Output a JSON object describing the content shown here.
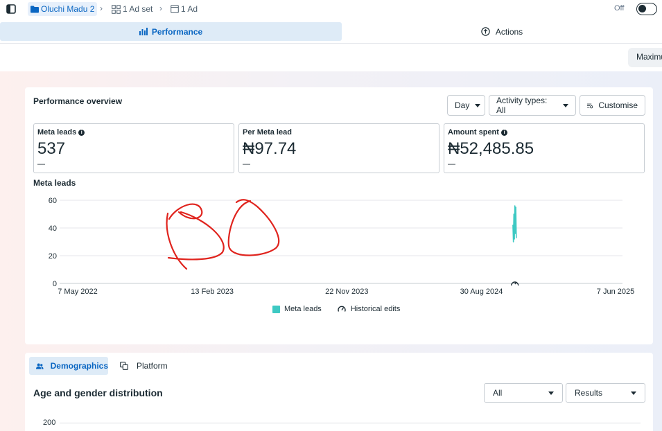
{
  "breadcrumb": {
    "campaign": "Oluchi Madu 2",
    "ad_set": "1 Ad set",
    "ad": "1 Ad"
  },
  "status_toggle": {
    "label": "Off",
    "on": false
  },
  "tabs": {
    "performance": "Performance",
    "actions": "Actions"
  },
  "maximize_button": "Maximu",
  "overview": {
    "title": "Performance overview",
    "day_select": "Day",
    "activity_select": "Activity types: All",
    "customise": "Customise",
    "metrics": [
      {
        "label": "Meta leads",
        "value": "537",
        "delta": "—",
        "info": true
      },
      {
        "label": "Per Meta lead",
        "value": "₦97.74",
        "delta": "—",
        "info": false
      },
      {
        "label": "Amount spent",
        "value": "₦52,485.85",
        "delta": "—",
        "info": true
      }
    ]
  },
  "chart_data": {
    "type": "line",
    "title": "Meta leads",
    "ylim": [
      0,
      60
    ],
    "y_ticks": [
      "0",
      "20",
      "40",
      "60"
    ],
    "x_ticks": [
      "7 May 2022",
      "13 Feb 2023",
      "22 Nov 2023",
      "30 Aug 2024",
      "7 Jun 2025"
    ],
    "grid": true,
    "legend_position": "bottom",
    "series": [
      {
        "name": "Meta leads",
        "color": "#3ec9c3",
        "points": [
          {
            "x": "2024-11-04",
            "y": 42
          },
          {
            "x": "2024-11-05",
            "y": 30
          },
          {
            "x": "2024-11-06",
            "y": 50
          },
          {
            "x": "2024-11-07",
            "y": 32
          },
          {
            "x": "2024-11-08",
            "y": 56
          },
          {
            "x": "2024-11-09",
            "y": 36
          },
          {
            "x": "2024-11-10",
            "y": 55
          },
          {
            "x": "2024-11-11",
            "y": 33
          }
        ]
      }
    ],
    "historical_edits_label": "Historical edits",
    "historical_edit_dates": [
      "2024-11-08"
    ],
    "annotation_text": "BO",
    "annotation_color": "#e0241e"
  },
  "demographics": {
    "tab_demographics": "Demographics",
    "tab_platform": "Platform",
    "title": "Age and gender distribution",
    "filter_select": "All",
    "metric_select": "Results",
    "y_top": "200"
  }
}
